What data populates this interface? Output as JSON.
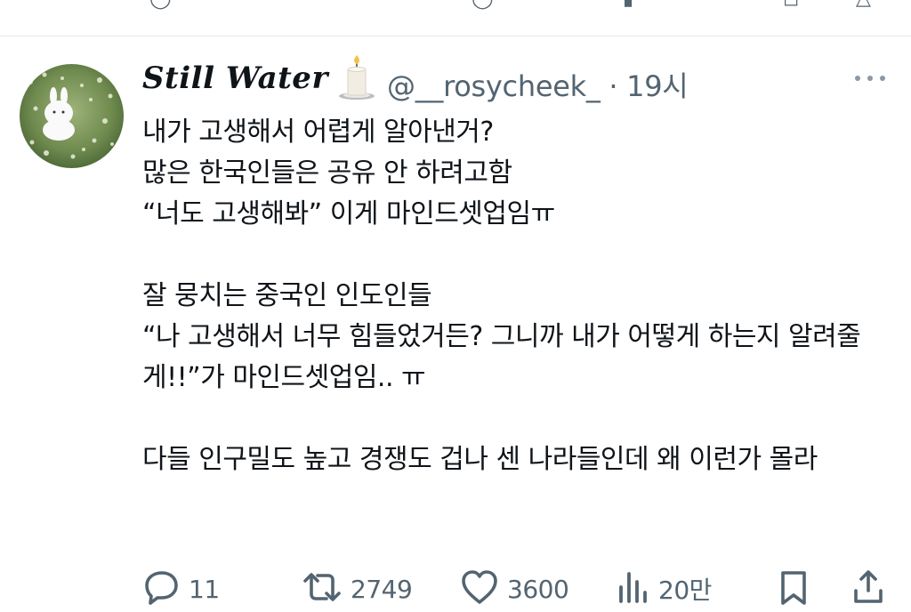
{
  "user": {
    "display_name": "Still Water",
    "badge_icon": "candle-icon",
    "handle": "@__rosycheek_",
    "separator": "·",
    "time": "19시"
  },
  "tweet": {
    "text": "내가 고생해서 어렵게 알아낸거?\n많은 한국인들은 공유 안 하려고함\n“너도 고생해봐” 이게 마인드셋업임ㅠ\n\n잘 뭉치는 중국인 인도인들\n“나 고생해서 너무 힘들었거든? 그니까 내가 어떻게 하는지 알려줄게!!”가 마인드셋업임.. ㅠ\n\n다들 인구밀도 높고 경쟁도 겁나 센 나라들인데 왜 이런가 몰라"
  },
  "actions": {
    "reply_icon": "reply-icon",
    "reply_count": "11",
    "retweet_icon": "retweet-icon",
    "retweet_count": "2749",
    "like_icon": "heart-icon",
    "like_count": "3600",
    "views_icon": "views-icon",
    "views_count": "20만",
    "bookmark_icon": "bookmark-icon",
    "share_icon": "share-icon"
  },
  "colors": {
    "text": "#0f1419",
    "muted": "#536471",
    "divider": "#e6e9ec"
  }
}
